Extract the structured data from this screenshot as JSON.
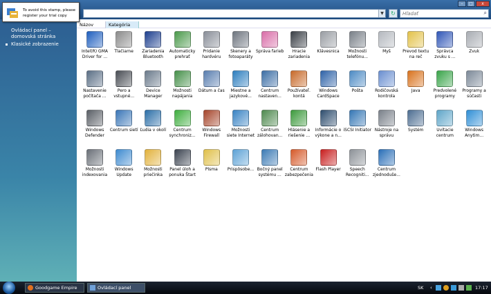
{
  "window": {
    "search_placeholder": "Hľadať",
    "address_dropdown_icon": "chevron-down-icon",
    "refresh_icon": "refresh-icon",
    "search_icon": "search-icon",
    "buttons": {
      "minimize": "–",
      "maximize": "□",
      "close": "x"
    }
  },
  "stamp": {
    "line1": "To avoid this stamp, please",
    "line2": "register your trial copy"
  },
  "sidebar": {
    "home_link": "Ovládací panel – domovská stránka",
    "classic_view": "Klasické zobrazenie"
  },
  "columns": {
    "name": "Názov",
    "category": "Kategória"
  },
  "items": [
    {
      "label": "Intel(R) GMA Driver for ...",
      "color": "#1f5fbf"
    },
    {
      "label": "Tlačiarne",
      "color": "#8c8c8c"
    },
    {
      "label": "Zariadenia Bluetooth",
      "color": "#1d3f8f"
    },
    {
      "label": "Automaticky prehrať",
      "color": "#4b9a4b"
    },
    {
      "label": "Pridanie hardvéru",
      "color": "#8a8f99"
    },
    {
      "label": "Skenery a fotoaparáty",
      "color": "#6f7680"
    },
    {
      "label": "Správa farieb",
      "color": "#d96ea8"
    },
    {
      "label": "Hracie zariadenia",
      "color": "#3a3f46"
    },
    {
      "label": "Klávesnica",
      "color": "#9a9ea4"
    },
    {
      "label": "Možnosti telefónu...",
      "color": "#7a8189"
    },
    {
      "label": "Myš",
      "color": "#b5b9bf"
    },
    {
      "label": "Prevod textu na reč",
      "color": "#e3c24a"
    },
    {
      "label": "Správca zvuku s ...",
      "color": "#3157b8"
    },
    {
      "label": "Zvuk",
      "color": "#a9adb3"
    },
    {
      "label": "Nastavenie počítača ...",
      "color": "#5b6f86"
    },
    {
      "label": "Pero a vstupné...",
      "color": "#4a4e55"
    },
    {
      "label": "Device Manager",
      "color": "#6b7b8c"
    },
    {
      "label": "Možnosti napájania",
      "color": "#46914a"
    },
    {
      "label": "Dátum a čas",
      "color": "#5a7fb0"
    },
    {
      "label": "Miestne a jazykové...",
      "color": "#2e7fbf"
    },
    {
      "label": "Centrum nastaven...",
      "color": "#3d6fa6"
    },
    {
      "label": "Používateľ. kontá",
      "color": "#c86a2a"
    },
    {
      "label": "Windows CardSpace",
      "color": "#2f63a8"
    },
    {
      "label": "Pošta",
      "color": "#4d8bc4"
    },
    {
      "label": "Rodičovská kontrola",
      "color": "#6a8fd0"
    },
    {
      "label": "Java",
      "color": "#d9731e"
    },
    {
      "label": "Predvolené programy",
      "color": "#3aa54a"
    },
    {
      "label": "Programy a súčasti",
      "color": "#7d8a99"
    },
    {
      "label": "Windows Defender",
      "color": "#5a5f66"
    },
    {
      "label": "Centrum sietí",
      "color": "#3b77b8"
    },
    {
      "label": "Ľudia v okolí",
      "color": "#2c6fa8"
    },
    {
      "label": "Centrum synchroniz...",
      "color": "#3eae3e"
    },
    {
      "label": "Windows Firewall",
      "color": "#a6452b"
    },
    {
      "label": "Možnosti siete Internet",
      "color": "#3a84c4"
    },
    {
      "label": "Centrum zálohovan...",
      "color": "#4f8a4f"
    },
    {
      "label": "Hlásenie a riešenie ...",
      "color": "#3c9a3c"
    },
    {
      "label": "Informácie o výkone a n...",
      "color": "#2e4d6e"
    },
    {
      "label": "iSCSI Initiator",
      "color": "#3577b5"
    },
    {
      "label": "Nástroje na správu",
      "color": "#7a818a"
    },
    {
      "label": "Systém",
      "color": "#4d6e92"
    },
    {
      "label": "Uvítacie centrum",
      "color": "#5fa6c9"
    },
    {
      "label": "Windows Anytim...",
      "color": "#2f8fd6"
    },
    {
      "label": "Možnosti indexovania",
      "color": "#6a7078"
    },
    {
      "label": "Windows Update",
      "color": "#3e8bd0"
    },
    {
      "label": "Možnosti priečinka",
      "color": "#e2b23c"
    },
    {
      "label": "Panel úloh a ponuka Štart",
      "color": "#3b4350"
    },
    {
      "label": "Písma",
      "color": "#e0c04a"
    },
    {
      "label": "Prispôsobe...",
      "color": "#5ea3d6"
    },
    {
      "label": "Bočný panel systému ...",
      "color": "#3c7bb5"
    },
    {
      "label": "Centrum zabezpečenia",
      "color": "#d65a2a"
    },
    {
      "label": "Flash Player",
      "color": "#c81e1e"
    },
    {
      "label": "Speech Recogniti...",
      "color": "#8d9298"
    },
    {
      "label": "Centrum zjednoduše...",
      "color": "#2a6fb8"
    }
  ],
  "taskbar": {
    "tasks": [
      {
        "label": "Goodgame Empire |..."
      },
      {
        "label": "Ovládací panel"
      }
    ],
    "lang": "SK",
    "time": "17:17"
  }
}
